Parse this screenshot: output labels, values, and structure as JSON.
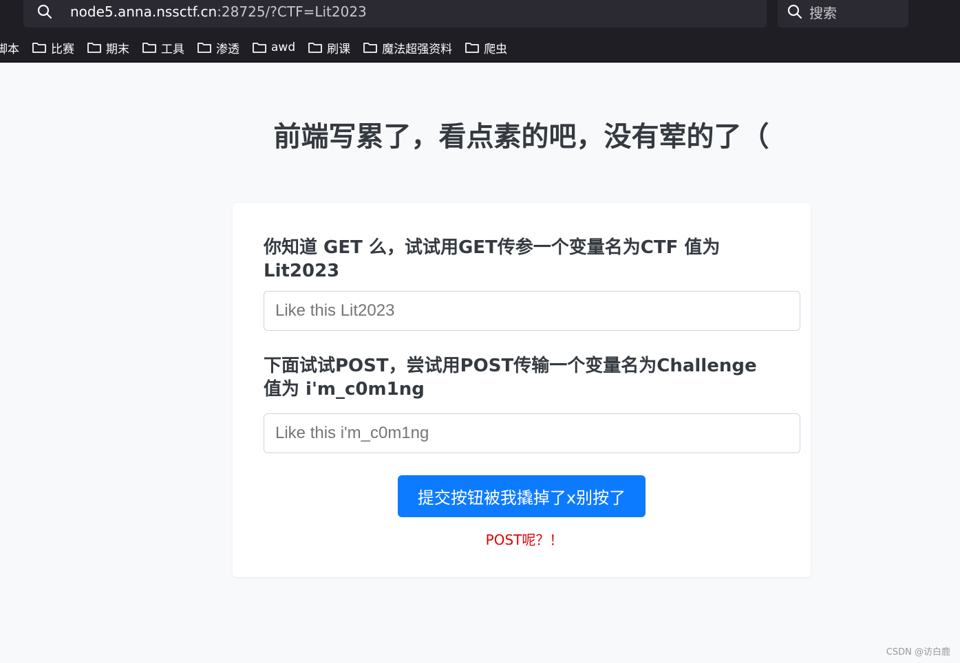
{
  "browser": {
    "url_host": "node5.anna.nssctf.cn",
    "url_rest": ":28725/?CTF=Lit2023",
    "search_label": "搜索",
    "bookmarks": [
      "脚本",
      "比赛",
      "期末",
      "工具",
      "渗透",
      "awd",
      "刷课",
      "魔法超强资料",
      "爬虫"
    ]
  },
  "page": {
    "title": "前端写累了，看点素的吧，没有荤的了（",
    "question1": "你知道 GET 么，试试用GET传参一个变量名为CTF 值为 Lit2023",
    "input1_placeholder": "Like this Lit2023",
    "question2": "下面试试POST，尝试用POST传输一个变量名为Challenge 值为 i'm_c0m1ng",
    "input2_placeholder": "Like this i'm_c0m1ng",
    "submit_label": "提交按钮被我撬掉了x别按了",
    "message": "POST呢？！",
    "message_color": "#e00000",
    "button_color": "#0d7bff"
  },
  "watermark": "CSDN @访白鹿"
}
